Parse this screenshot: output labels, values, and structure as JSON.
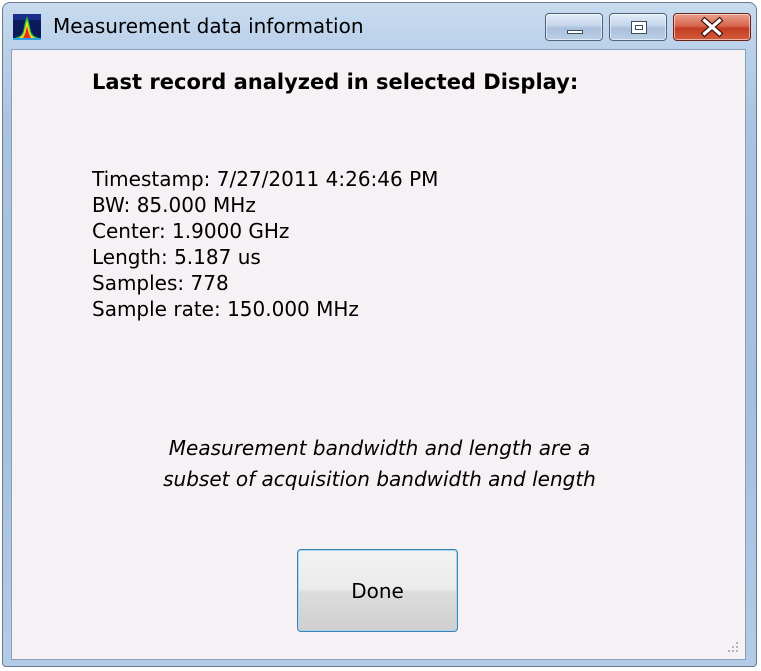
{
  "window": {
    "title": "Measurement data information",
    "icons": {
      "app": "spectrum-app-icon",
      "minimize": "minimize-icon",
      "maximize": "maximize-icon",
      "close": "close-icon",
      "grip": "resize-grip-icon"
    }
  },
  "content": {
    "heading": "Last record analyzed in selected Display:",
    "info_lines": [
      "Timestamp: 7/27/2011 4:26:46 PM",
      "BW: 85.000 MHz",
      "Center: 1.9000 GHz",
      "Length: 5.187 us",
      "Samples: 778",
      "Sample rate: 150.000 MHz"
    ],
    "note_lines": [
      "Measurement bandwidth and length are a",
      "subset of acquisition bandwidth and length"
    ],
    "done_label": "Done"
  },
  "colors": {
    "frame": "#a9c3e0",
    "client_bg": "#f5f1f5",
    "close_button": "#c94a2c",
    "button_focus": "#3c7fb1"
  }
}
